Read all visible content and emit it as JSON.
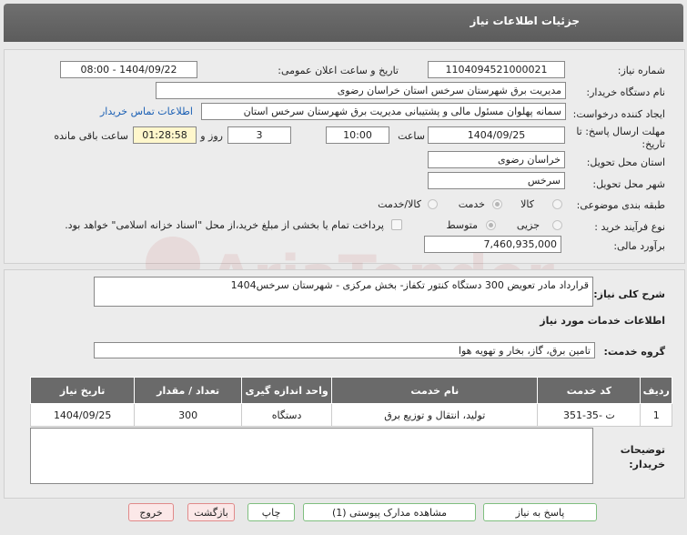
{
  "header": {
    "title": "جزئیات اطلاعات نیاز"
  },
  "fields": {
    "need_number_label": "شماره نیاز:",
    "need_number": "1104094521000021",
    "announce_label": "تاریخ و ساعت اعلان عمومی:",
    "announce_value": "1404/09/22 - 08:00",
    "buyer_label": "نام دستگاه خریدار:",
    "buyer_value": "مدیریت برق شهرستان سرخس استان خراسان رضوی",
    "creator_label": "ایجاد کننده درخواست:",
    "creator_value": "سمانه پهلوان مسئول مالی و پشتیبانی مدیریت برق شهرستان سرخس استان",
    "contact_link": "اطلاعات تماس خریدار",
    "deadline_label": "مهلت ارسال پاسخ: تا",
    "deadline_label2": "تاریخ:",
    "deadline_date": "1404/09/25",
    "time_label": "ساعت",
    "deadline_time": "10:00",
    "days_value": "3",
    "days_label": "روز و",
    "remaining_time": "01:28:58",
    "remaining_label": "ساعت باقی مانده",
    "province_label": "استان محل تحویل:",
    "province_value": "خراسان رضوی",
    "city_label": "شهر محل تحویل:",
    "city_value": "سرخس",
    "category_label": "طبقه بندی موضوعی:",
    "cat_goods": "کالا",
    "cat_service": "خدمت",
    "cat_goods_service": "کالا/خدمت",
    "process_label": "نوع فرآیند خرید :",
    "proc_small": "جزیی",
    "proc_medium": "متوسط",
    "payment_note": "پرداخت تمام یا بخشی از مبلغ خرید،از محل \"اسناد خزانه اسلامی\" خواهد بود.",
    "estimate_label": "برآورد مالی:",
    "estimate_value": "7,460,935,000"
  },
  "general": {
    "desc_label": "شرح کلی نیاز:",
    "desc_value": "قرارداد مادر تعویض 300 دستگاه کنتور تکفاز- بخش مرکزی - شهرستان سرخس1404",
    "services_title": "اطلاعات خدمات مورد نیاز",
    "group_label": "گروه خدمت:",
    "group_value": "تامین برق، گاز، بخار و تهویه هوا"
  },
  "table": {
    "headers": [
      "ردیف",
      "کد خدمت",
      "نام خدمت",
      "واحد اندازه گیری",
      "تعداد / مقدار",
      "تاریخ نیاز"
    ],
    "rows": [
      [
        "1",
        "ت -35-351",
        "تولید، انتقال و توزیع برق",
        "دستگاه",
        "300",
        "1404/09/25"
      ]
    ]
  },
  "notes": {
    "label_line1": "توضیحات",
    "label_line2": "خریدار:"
  },
  "buttons": {
    "reply": "پاسخ به نیاز",
    "attachments": "مشاهده مدارک پیوستی (1)",
    "print": "چاپ",
    "back": "بازگشت",
    "exit": "خروج"
  },
  "watermark": "AriaTender.neT",
  "colors": {
    "header": "#666666",
    "link": "#1a5fb4",
    "button_border": "#7fbf7f",
    "button_red": "#fbe8e8"
  }
}
